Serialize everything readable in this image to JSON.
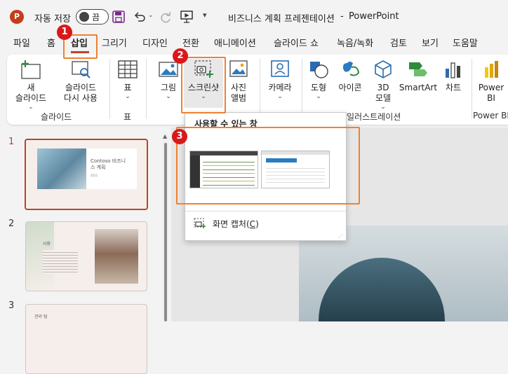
{
  "titlebar": {
    "autosave_label": "자동 저장",
    "toggle_state": "끔",
    "doc_title": "비즈니스 계획 프레젠테이션",
    "separator": "-",
    "app_name": "PowerPoint"
  },
  "tabs": [
    "파일",
    "홈",
    "삽입",
    "그리기",
    "디자인",
    "전환",
    "애니메이션",
    "슬라이드 쇼",
    "녹음/녹화",
    "검토",
    "보기",
    "도움말"
  ],
  "ribbon": {
    "new_slide": "새\n슬라이드",
    "reuse_slide": "슬라이드\n다시 사용",
    "table": "표",
    "pictures": "그림",
    "screenshot": "스크린샷",
    "photo_album": "사진\n앨범",
    "camera": "카메라",
    "shapes": "도형",
    "icons": "아이콘",
    "models_3d": "3D\n모델",
    "smartart": "SmartArt",
    "chart": "차트",
    "powerbi": "Power\nBI",
    "group_slides": "슬라이드",
    "group_table": "표",
    "group_illustrations": "일러스트레이션",
    "group_powerbi": "Power BI"
  },
  "dropdown": {
    "heading": "사용할 수 있는 창",
    "screen_clipping": "화면 캡처(",
    "screen_clipping_key": "C",
    "screen_clipping_end": ")"
  },
  "thumbnails": [
    {
      "num": "1",
      "title": "Contoso 비즈니\n스 계획",
      "sub": "2011"
    },
    {
      "num": "2",
      "title": "사용"
    },
    {
      "num": "3",
      "title": "관리 팀"
    }
  ],
  "callouts": [
    "1",
    "2",
    "3"
  ],
  "colors": {
    "accent": "#b7472a",
    "callout": "#d9181b",
    "highlight": "#f08030"
  }
}
